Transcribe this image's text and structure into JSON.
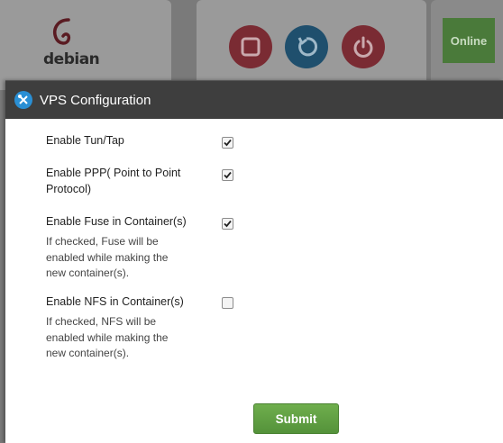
{
  "background": {
    "logo_text": "debian",
    "online_label": "Online",
    "controls": [
      {
        "name": "stop",
        "icon": "stop-icon",
        "color": "#7a2b33"
      },
      {
        "name": "restart",
        "icon": "restart-icon",
        "color": "#1f4f6d"
      },
      {
        "name": "power",
        "icon": "power-icon",
        "color": "#7a2b33"
      }
    ]
  },
  "modal": {
    "title": "VPS Configuration",
    "header_icon": "tools-icon",
    "options": [
      {
        "label": "Enable Tun/Tap",
        "checked": true,
        "help": ""
      },
      {
        "label": "Enable PPP( Point to Point Protocol)",
        "checked": true,
        "help": ""
      },
      {
        "label": "Enable Fuse in Container(s)",
        "checked": true,
        "help": "If checked, Fuse will be enabled while making the new container(s)."
      },
      {
        "label": "Enable NFS in Container(s)",
        "checked": false,
        "help": "If checked, NFS will be enabled while making the new container(s)."
      }
    ],
    "submit_label": "Submit"
  },
  "colors": {
    "header_bg": "#3e3e3e",
    "accent_blue": "#2a8fd4",
    "submit_green": "#5fa044"
  }
}
